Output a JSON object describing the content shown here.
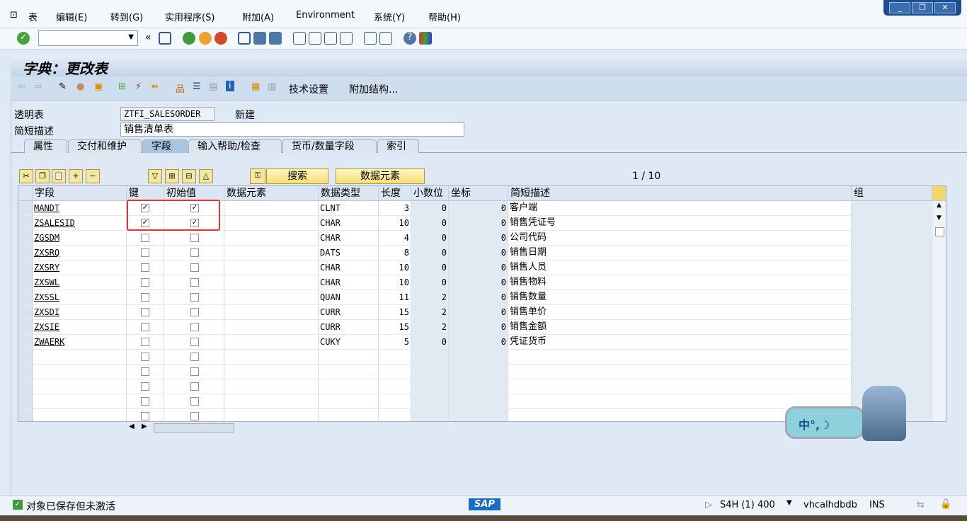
{
  "menu": [
    "表",
    "编辑(E)",
    "转到(G)",
    "实用程序(S)",
    "附加(A)",
    "Environment",
    "系统(Y)",
    "帮助(H)"
  ],
  "window_buttons": [
    "_",
    "❐",
    "✕"
  ],
  "title": "字典：更改表",
  "app_toolbar": {
    "tech_settings": "技术设置",
    "append_structure": "附加结构..."
  },
  "header": {
    "table_label": "透明表",
    "table_value": "ZTFI_SALESORDER",
    "status": "新建",
    "desc_label": "简短描述",
    "desc_value": "销售清单表"
  },
  "tabs": [
    "属性",
    "交付和维护",
    "字段",
    "输入帮助/检查",
    "货币/数量字段",
    "索引"
  ],
  "active_tab": 2,
  "grid_buttons": {
    "search": "搜索",
    "data_element": "数据元素",
    "page": "1 / 10"
  },
  "columns": [
    "字段",
    "键",
    "初始值",
    "数据元素",
    "数据类型",
    "长度",
    "小数位",
    "坐标",
    "简短描述",
    "组"
  ],
  "rows": [
    {
      "field": "MANDT",
      "key": true,
      "init": true,
      "elem": "",
      "type": "CLNT",
      "len": "3",
      "dec": "0",
      "coord": "0",
      "desc": "客户端"
    },
    {
      "field": "ZSALESID",
      "key": true,
      "init": true,
      "elem": "",
      "type": "CHAR",
      "len": "10",
      "dec": "0",
      "coord": "0",
      "desc": "销售凭证号"
    },
    {
      "field": "ZGSDM",
      "key": false,
      "init": false,
      "elem": "",
      "type": "CHAR",
      "len": "4",
      "dec": "0",
      "coord": "0",
      "desc": "公司代码"
    },
    {
      "field": "ZXSRQ",
      "key": false,
      "init": false,
      "elem": "",
      "type": "DATS",
      "len": "8",
      "dec": "0",
      "coord": "0",
      "desc": "销售日期"
    },
    {
      "field": "ZXSRY",
      "key": false,
      "init": false,
      "elem": "",
      "type": "CHAR",
      "len": "10",
      "dec": "0",
      "coord": "0",
      "desc": "销售人员"
    },
    {
      "field": "ZXSWL",
      "key": false,
      "init": false,
      "elem": "",
      "type": "CHAR",
      "len": "10",
      "dec": "0",
      "coord": "0",
      "desc": "销售物料"
    },
    {
      "field": "ZXSSL",
      "key": false,
      "init": false,
      "elem": "",
      "type": "QUAN",
      "len": "11",
      "dec": "2",
      "coord": "0",
      "desc": "销售数量"
    },
    {
      "field": "ZXSDI",
      "key": false,
      "init": false,
      "elem": "",
      "type": "CURR",
      "len": "15",
      "dec": "2",
      "coord": "0",
      "desc": "销售单价"
    },
    {
      "field": "ZXSIE",
      "key": false,
      "init": false,
      "elem": "",
      "type": "CURR",
      "len": "15",
      "dec": "2",
      "coord": "0",
      "desc": "销售金额"
    },
    {
      "field": "ZWAERK",
      "key": false,
      "init": false,
      "elem": "",
      "type": "CUKY",
      "len": "5",
      "dec": "0",
      "coord": "0",
      "desc": "凭证货币"
    }
  ],
  "empty_rows": 5,
  "ime": "中°,☽",
  "status": {
    "message": "对象已保存但未激活",
    "system": "S4H (1) 400",
    "host": "vhcalhdbdb",
    "mode": "INS",
    "logo": "SAP"
  },
  "colors": {
    "accent_red": "#e53333",
    "title_bg": "#c3d4e8"
  }
}
